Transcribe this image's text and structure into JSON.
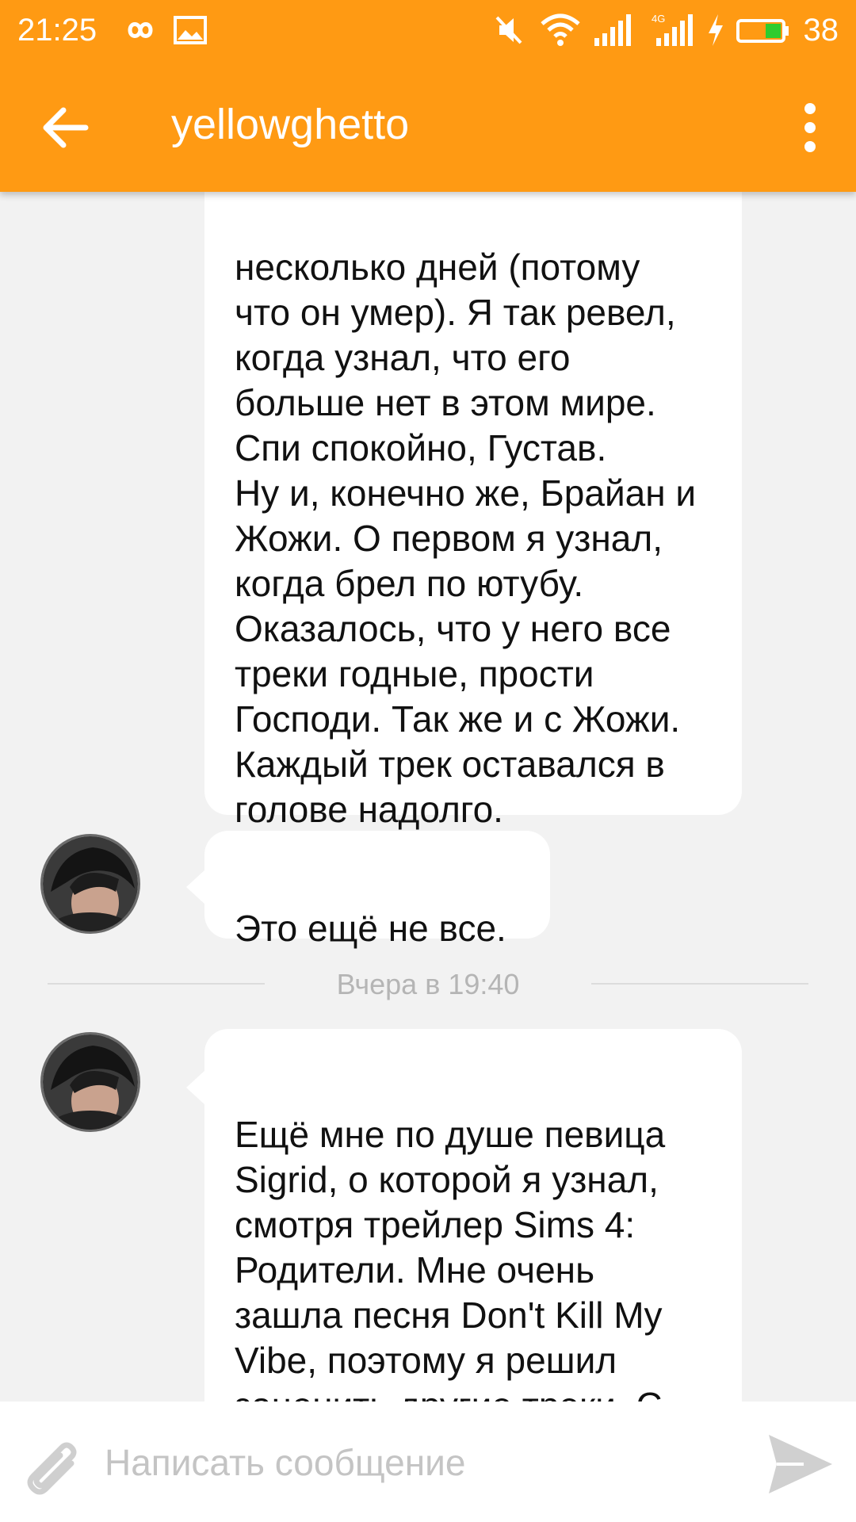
{
  "status_bar": {
    "time": "21:25",
    "battery_percent": "38",
    "icons": [
      "infinity-icon",
      "gallery-icon",
      "mute-icon",
      "wifi-icon",
      "signal-icon",
      "signal-4g-icon",
      "charging-icon",
      "battery-icon"
    ]
  },
  "toolbar": {
    "title": "yellowghetto",
    "back_icon": "arrow-left-icon",
    "menu_icon": "more-vertical-icon"
  },
  "messages": [
    {
      "text": "несколько дней (потому\nчто он умер). Я так ревел,\nкогда узнал, что его\nбольше нет в этом мире.\nСпи спокойно, Густав.\nНу и, конечно же, Брайан и\nЖожи. О первом я узнал,\nкогда брел по ютубу.\nОказалось, что у него все\nтреки годные, прости\nГосподи. Так же и с Жожи.\nКаждый трек оставался в\nголове надолго."
    },
    {
      "text": "Это ещё не все."
    },
    {
      "text": "Ещё мне по душе певица\nSigrid, о которой я узнал,\nсмотря трейлер Sims 4:\nРодители. Мне очень\nзашла песня Don't Kill My\nVibe, поэтому я решил\nзаценить другие треки. С\nтех пор я обожаю её"
    }
  ],
  "date_separator": "Вчера в 19:40",
  "composer": {
    "placeholder": "Написать сообщение",
    "attach_icon": "paperclip-icon",
    "send_icon": "send-icon"
  },
  "colors": {
    "accent": "#ff9a13",
    "background": "#f2f2f2",
    "bubble": "#ffffff",
    "date_text": "#b5b5b5",
    "placeholder": "#c4c4c4"
  }
}
